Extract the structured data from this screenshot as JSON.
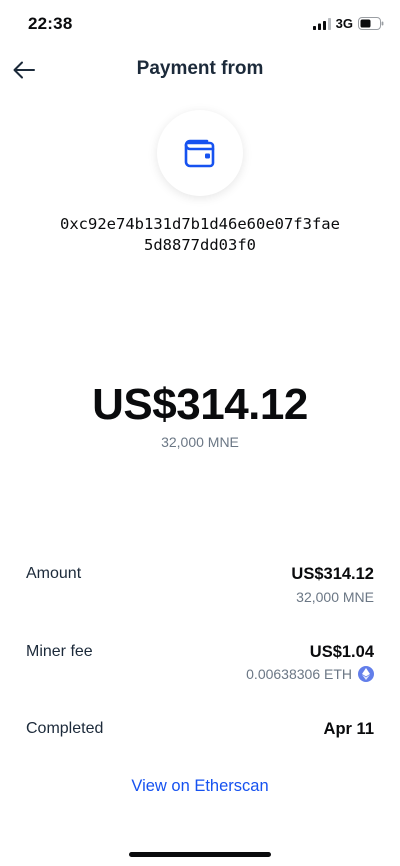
{
  "status_bar": {
    "time": "22:38",
    "network": "3G",
    "icons": [
      "signal-icon",
      "battery-icon"
    ]
  },
  "header": {
    "title": "Payment from",
    "back_icon": "arrow-left-icon"
  },
  "sender": {
    "icon": "wallet-icon",
    "address_line1": "0xc92e74b131d7b1d46e60e07f3fae",
    "address_line2": "5d8877dd03f0"
  },
  "hero": {
    "amount": "US$314.12",
    "crypto_amount": "32,000 MNE"
  },
  "details": {
    "amount": {
      "label": "Amount",
      "value": "US$314.12",
      "sub": "32,000 MNE"
    },
    "miner_fee": {
      "label": "Miner fee",
      "value": "US$1.04",
      "sub": "0.00638306 ETH",
      "icon": "ethereum-icon"
    },
    "completed": {
      "label": "Completed",
      "value": "Apr 11"
    }
  },
  "link": {
    "label": "View on Etherscan"
  },
  "colors": {
    "accent": "#1652f0",
    "muted": "#6b7785",
    "eth": "#627eea"
  }
}
